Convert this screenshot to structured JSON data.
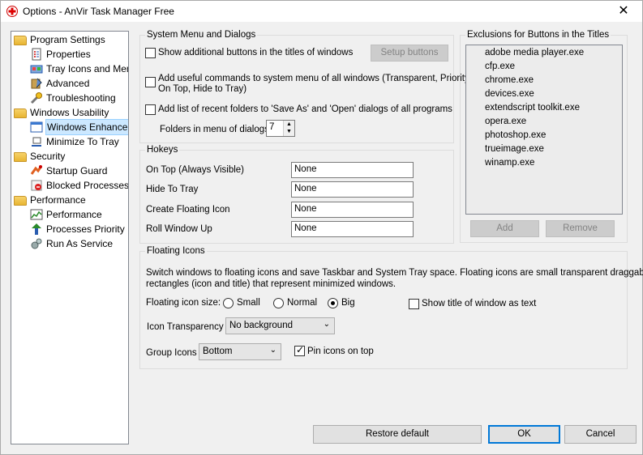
{
  "window": {
    "title": "Options - AnVir Task Manager Free",
    "close_glyph": "✕"
  },
  "tree": [
    {
      "label": "Program Settings",
      "icon": "folder-icon",
      "level": 0,
      "selected": false
    },
    {
      "label": "Properties",
      "icon": "properties-icon",
      "level": 1,
      "selected": false
    },
    {
      "label": "Tray Icons and Menu",
      "icon": "tray-icons-icon",
      "level": 1,
      "selected": false
    },
    {
      "label": "Advanced",
      "icon": "advanced-icon",
      "level": 1,
      "selected": false
    },
    {
      "label": "Troubleshooting",
      "icon": "troubleshooting-icon",
      "level": 1,
      "selected": false
    },
    {
      "label": "Windows Usability",
      "icon": "folder-icon",
      "level": 0,
      "selected": false
    },
    {
      "label": "Windows Enhancements",
      "icon": "windows-enhancements-icon",
      "level": 1,
      "selected": true
    },
    {
      "label": "Minimize To Tray",
      "icon": "minimize-tray-icon",
      "level": 1,
      "selected": false
    },
    {
      "label": "Security",
      "icon": "folder-icon",
      "level": 0,
      "selected": false
    },
    {
      "label": "Startup Guard",
      "icon": "startup-guard-icon",
      "level": 1,
      "selected": false
    },
    {
      "label": "Blocked Processes",
      "icon": "blocked-processes-icon",
      "level": 1,
      "selected": false
    },
    {
      "label": "Performance",
      "icon": "folder-icon",
      "level": 0,
      "selected": false
    },
    {
      "label": "Performance",
      "icon": "performance-icon",
      "level": 1,
      "selected": false
    },
    {
      "label": "Processes Priority",
      "icon": "processes-priority-icon",
      "level": 1,
      "selected": false
    },
    {
      "label": "Run As Service",
      "icon": "run-as-service-icon",
      "level": 1,
      "selected": false
    }
  ],
  "system_menu": {
    "legend": "System Menu and Dialogs",
    "show_buttons_label": "Show additional buttons in the titles of windows",
    "show_buttons_checked": false,
    "setup_buttons_label": "Setup buttons",
    "add_commands_label_line1": "Add useful commands to system menu of all windows (Transparent, Priority,",
    "add_commands_label_line2": "On Top, Hide to Tray)",
    "add_commands_checked": false,
    "recent_folders_label": "Add list of recent folders to 'Save As' and 'Open' dialogs of all programs",
    "recent_folders_checked": false,
    "folders_count_label": "Folders in menu of dialogs:",
    "folders_count_value": "7",
    "spin_up_glyph": "▲",
    "spin_down_glyph": "▼"
  },
  "exclusions": {
    "legend": "Exclusions for Buttons in the Titles",
    "items": [
      "adobe media player.exe",
      "cfp.exe",
      "chrome.exe",
      "devices.exe",
      "extendscript toolkit.exe",
      "opera.exe",
      "photoshop.exe",
      "trueimage.exe",
      "winamp.exe"
    ],
    "add_label": "Add",
    "remove_label": "Remove"
  },
  "hotkeys": {
    "legend": "Hokeys",
    "rows": [
      {
        "label": "On Top (Always Visible)",
        "value": "None"
      },
      {
        "label": "Hide To Tray",
        "value": "None"
      },
      {
        "label": "Create Floating Icon",
        "value": "None"
      },
      {
        "label": "Roll Window Up",
        "value": "None"
      }
    ]
  },
  "floating": {
    "legend": "Floating Icons",
    "description_line1": "Switch windows to floating icons and save Taskbar and System Tray space. Floating icons are small transparent draggable",
    "description_line2": "rectangles (icon and title) that represent minimized windows.",
    "size_label": "Floating icon size:",
    "size_options": [
      "Small",
      "Normal",
      "Big"
    ],
    "size_selected": "Big",
    "show_title_label": "Show title of window as text",
    "show_title_checked": false,
    "transparency_label": "Icon Transparency",
    "transparency_value": "No background",
    "group_label": "Group Icons",
    "group_value": "Bottom",
    "pin_label": "Pin icons on top",
    "pin_checked": true,
    "dropdown_glyph": "⌄"
  },
  "footer": {
    "restore_label": "Restore default",
    "ok_label": "OK",
    "cancel_label": "Cancel"
  }
}
